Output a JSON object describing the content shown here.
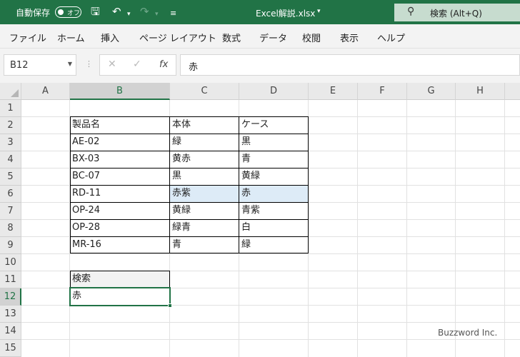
{
  "titlebar": {
    "autosave_label": "自動保存",
    "autosave_state": "オフ",
    "filename": "Excel解説.xlsx",
    "search_label": "検索 (Alt+Q)"
  },
  "ribbon": {
    "tabs": [
      "ファイル",
      "ホーム",
      "挿入",
      "ページ レイアウト",
      "数式",
      "データ",
      "校閲",
      "表示",
      "ヘルプ"
    ]
  },
  "formula_bar": {
    "name_box": "B12",
    "fx_label": "fx",
    "content": "赤"
  },
  "grid": {
    "columns": [
      "A",
      "B",
      "C",
      "D",
      "E",
      "F",
      "G",
      "H"
    ],
    "rows": [
      "1",
      "2",
      "3",
      "4",
      "5",
      "6",
      "7",
      "8",
      "9",
      "10",
      "11",
      "12",
      "13",
      "14",
      "15"
    ],
    "selected_column": "B",
    "selected_row": "12"
  },
  "table": {
    "headers": [
      "製品名",
      "本体",
      "ケース"
    ],
    "rows": [
      [
        "AE-02",
        "緑",
        "黒"
      ],
      [
        "BX-03",
        "黄赤",
        "青"
      ],
      [
        "BC-07",
        "黒",
        "黄緑"
      ],
      [
        "RD-11",
        "赤紫",
        "赤"
      ],
      [
        "OP-24",
        "黄緑",
        "青紫"
      ],
      [
        "OP-28",
        "緑青",
        "白"
      ],
      [
        "MR-16",
        "青",
        "緑"
      ]
    ]
  },
  "search_block": {
    "label": "検索",
    "value": "赤"
  },
  "watermark": "Buzzword Inc.",
  "colors": {
    "excel_green": "#217346",
    "highlight": "#ddebf7"
  }
}
